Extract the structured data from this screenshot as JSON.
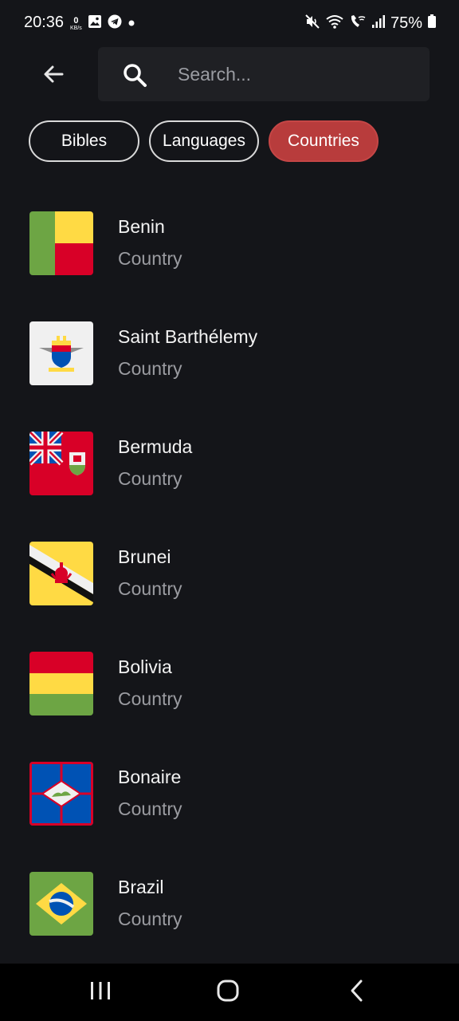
{
  "status_bar": {
    "time": "20:36",
    "net_speed_value": "0",
    "net_speed_unit": "KB/s",
    "battery": "75%",
    "icons": [
      "gallery-icon",
      "telegram-icon",
      "dot-icon",
      "mute-icon",
      "wifi-icon",
      "wifi-calling-icon",
      "signal-icon",
      "battery-icon"
    ]
  },
  "header": {
    "back_icon": "arrow-left-icon",
    "search_icon": "magnifier-icon",
    "search_placeholder": "Search..."
  },
  "filters": [
    {
      "label": "Bibles",
      "active": false
    },
    {
      "label": "Languages",
      "active": false
    },
    {
      "label": "Countries",
      "active": true
    }
  ],
  "colors": {
    "background": "#141519",
    "search_bg": "#1f2024",
    "active_chip": "#b83c3c",
    "subtitle": "#9b9ca1"
  },
  "countries": [
    {
      "name": "Benin",
      "type": "Country",
      "flag": "benin-flag"
    },
    {
      "name": "Saint Barthélemy",
      "type": "Country",
      "flag": "saint-barthelemy-flag"
    },
    {
      "name": "Bermuda",
      "type": "Country",
      "flag": "bermuda-flag"
    },
    {
      "name": "Brunei",
      "type": "Country",
      "flag": "brunei-flag"
    },
    {
      "name": "Bolivia",
      "type": "Country",
      "flag": "bolivia-flag"
    },
    {
      "name": "Bonaire",
      "type": "Country",
      "flag": "bonaire-flag"
    },
    {
      "name": "Brazil",
      "type": "Country",
      "flag": "brazil-flag"
    }
  ],
  "nav_bar": {
    "recents_icon": "recents-icon",
    "home_icon": "home-icon",
    "back_icon": "back-chevron-icon"
  }
}
